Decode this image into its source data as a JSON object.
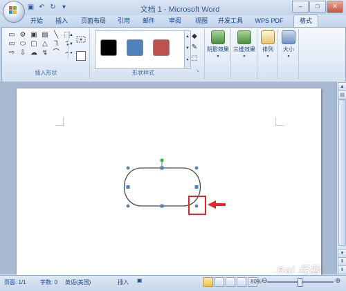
{
  "window": {
    "title": "文档 1 - Microsoft Word"
  },
  "quick_access": {
    "icons": [
      "save-icon",
      "undo-icon",
      "redo-icon",
      "customize-icon"
    ]
  },
  "tabs": [
    {
      "label": "开始",
      "active": false
    },
    {
      "label": "插入",
      "active": false
    },
    {
      "label": "页面布局",
      "active": false
    },
    {
      "label": "引用",
      "active": false
    },
    {
      "label": "邮件",
      "active": false
    },
    {
      "label": "审阅",
      "active": false
    },
    {
      "label": "视图",
      "active": false
    },
    {
      "label": "开发工具",
      "active": false
    },
    {
      "label": "WPS PDF",
      "active": false
    },
    {
      "label": "格式",
      "active": true
    }
  ],
  "ribbon": {
    "insert_shapes": {
      "label": "插入形状",
      "shape_glyphs": [
        "▭",
        "⚙",
        "▣",
        "▤",
        "╲",
        "⬚",
        "▭",
        "⬭",
        "▢",
        "△",
        "⅂",
        "↴",
        "⇨",
        "⇩",
        "☁",
        "↯",
        "⌒",
        "⌢"
      ]
    },
    "shape_styles": {
      "label": "形状样式",
      "swatches": [
        "#000000",
        "#4f81bd",
        "#c0504d"
      ]
    },
    "shadow_effects": {
      "label": "阴影效果"
    },
    "3d_effects": {
      "label": "三维效果"
    },
    "arrange": {
      "label": "排列"
    },
    "size": {
      "label": "大小"
    }
  },
  "status": {
    "page": "页面: 1/1",
    "words": "字数: 0",
    "language": "英语(美国)",
    "mode": "插入",
    "zoom": "80%"
  },
  "colors": {
    "accent": "#15428b",
    "highlight": "#e8232b",
    "handle": "#4f81bd",
    "rotate_handle": "#2fb52f"
  },
  "watermark": "Bai 经验"
}
